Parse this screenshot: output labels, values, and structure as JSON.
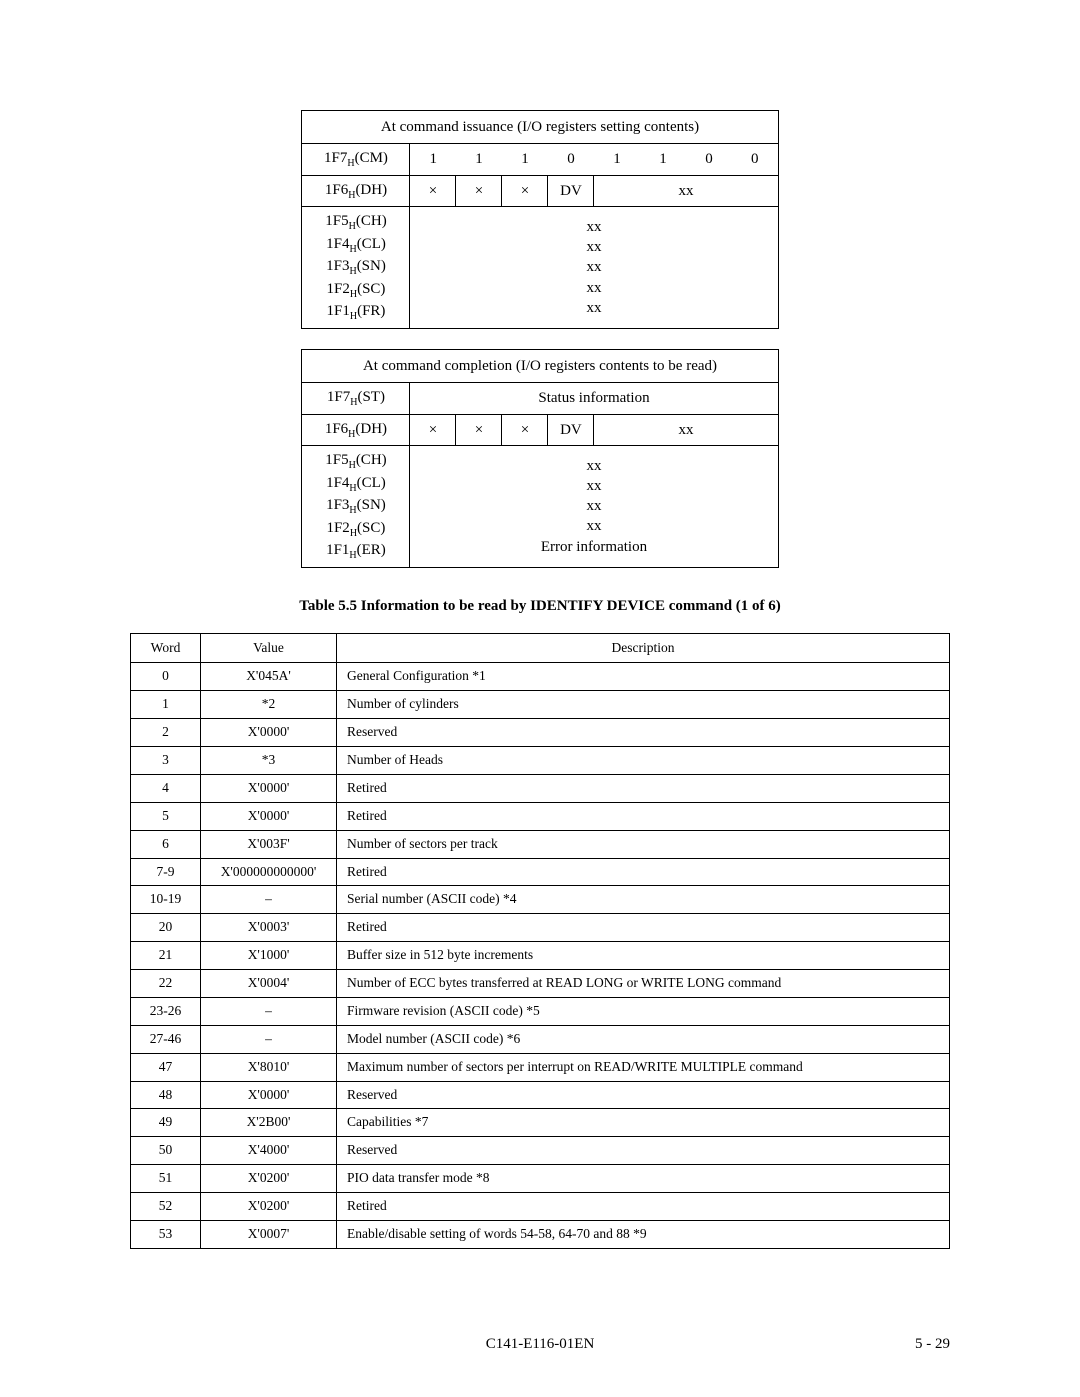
{
  "table1": {
    "header": "At command issuance (I/O registers setting contents)",
    "rows": {
      "cm": {
        "label": "1F7",
        "suffix": "(CM)",
        "bits": [
          "1",
          "1",
          "1",
          "0",
          "1",
          "1",
          "0",
          "0"
        ]
      },
      "dh": {
        "label": "1F6",
        "suffix": "(DH)",
        "b0": "×",
        "b1": "×",
        "b2": "×",
        "dv": "DV",
        "rest": "xx"
      },
      "block": {
        "labels": [
          "1F5",
          "1F4",
          "1F3",
          "1F2",
          "1F1"
        ],
        "suffixes": [
          "(CH)",
          "(CL)",
          "(SN)",
          "(SC)",
          "(FR)"
        ],
        "vals": [
          "xx",
          "xx",
          "xx",
          "xx",
          "xx"
        ]
      }
    }
  },
  "table2": {
    "header": "At command completion (I/O registers contents to be read)",
    "rows": {
      "st": {
        "label": "1F7",
        "suffix": "(ST)",
        "text": "Status information"
      },
      "dh": {
        "label": "1F6",
        "suffix": "(DH)",
        "b0": "×",
        "b1": "×",
        "b2": "×",
        "dv": "DV",
        "rest": "xx"
      },
      "block": {
        "labels": [
          "1F5",
          "1F4",
          "1F3",
          "1F2",
          "1F1"
        ],
        "suffixes": [
          "(CH)",
          "(CL)",
          "(SN)",
          "(SC)",
          "(ER)"
        ],
        "vals": [
          "xx",
          "xx",
          "xx",
          "xx",
          "Error information"
        ]
      }
    }
  },
  "caption": "Table 5.5    Information to be read by IDENTIFY DEVICE command (1 of 6)",
  "id_table": {
    "headers": [
      "Word",
      "Value",
      "Description"
    ],
    "rows": [
      {
        "w": "0",
        "v": "X'045A'",
        "d": "General Configuration  *1"
      },
      {
        "w": "1",
        "v": "*2",
        "d": "Number of cylinders"
      },
      {
        "w": "2",
        "v": "X'0000'",
        "d": "Reserved"
      },
      {
        "w": "3",
        "v": "*3",
        "d": "Number of Heads"
      },
      {
        "w": "4",
        "v": "X'0000'",
        "d": "Retired"
      },
      {
        "w": "5",
        "v": "X'0000'",
        "d": "Retired"
      },
      {
        "w": "6",
        "v": "X'003F'",
        "d": "Number of sectors per track"
      },
      {
        "w": "7-9",
        "v": "X'000000000000'",
        "d": "Retired"
      },
      {
        "w": "10-19",
        "v": "–",
        "d": "Serial number (ASCII code) *4"
      },
      {
        "w": "20",
        "v": "X'0003'",
        "d": "Retired"
      },
      {
        "w": "21",
        "v": "X'1000'",
        "d": "Buffer size in 512 byte increments"
      },
      {
        "w": "22",
        "v": "X'0004'",
        "d": "Number of ECC bytes transferred at READ LONG or WRITE LONG command"
      },
      {
        "w": "23-26",
        "v": "–",
        "d": "Firmware revision (ASCII code) *5"
      },
      {
        "w": "27-46",
        "v": "–",
        "d": "Model number (ASCII code) *6"
      },
      {
        "w": "47",
        "v": "X'8010'",
        "d": "Maximum number of sectors per interrupt on READ/WRITE MULTIPLE command"
      },
      {
        "w": "48",
        "v": "X'0000'",
        "d": "Reserved"
      },
      {
        "w": "49",
        "v": "X'2B00'",
        "d": "Capabilities *7"
      },
      {
        "w": "50",
        "v": "X'4000'",
        "d": "Reserved"
      },
      {
        "w": "51",
        "v": "X'0200'",
        "d": "PIO data transfer mode *8"
      },
      {
        "w": "52",
        "v": "X'0200'",
        "d": "Retired"
      },
      {
        "w": "53",
        "v": "X'0007'",
        "d": "Enable/disable setting of words 54-58, 64-70 and 88 *9"
      }
    ]
  },
  "footer": {
    "docid": "C141-E116-01EN",
    "pagenum": "5 - 29"
  }
}
